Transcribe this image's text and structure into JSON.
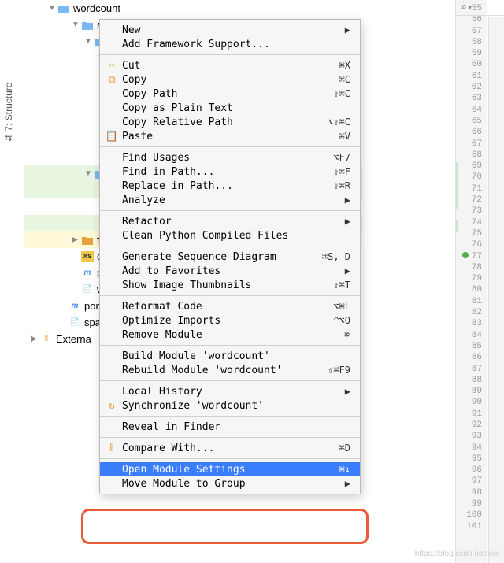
{
  "sidebar": {
    "structure_label": "Structure"
  },
  "tree": {
    "root": "wordcount",
    "items": [
      {
        "label": "s",
        "indent": 1,
        "chevron": "down",
        "icon": "folder-blue"
      },
      {
        "label": "",
        "indent": 2,
        "chevron": "down",
        "icon": "folder-blue"
      },
      {
        "label": "",
        "indent": 3,
        "chevron": "down",
        "icon": "folder-blue"
      },
      {
        "label": "",
        "indent": 4,
        "chevron": "down",
        "icon": "folder-blue"
      },
      {
        "label": "",
        "indent": 4,
        "chevron": "",
        "icon": ""
      },
      {
        "label": "",
        "indent": 4,
        "chevron": "",
        "icon": ""
      },
      {
        "label": "",
        "indent": 4,
        "chevron": "",
        "icon": ""
      },
      {
        "label": "",
        "indent": 4,
        "chevron": "",
        "icon": ""
      },
      {
        "label": "",
        "indent": 4,
        "chevron": "",
        "icon": ""
      },
      {
        "label": "",
        "indent": 2,
        "chevron": "down",
        "icon": "folder-blue",
        "class": "green"
      },
      {
        "label": "",
        "indent": 2,
        "chevron": "",
        "icon": "",
        "class": "green"
      },
      {
        "label": "",
        "indent": 2,
        "chevron": "",
        "icon": ""
      },
      {
        "label": "",
        "indent": 2,
        "chevron": "",
        "icon": "",
        "class": "green"
      },
      {
        "label": "t",
        "indent": 1,
        "chevron": "right",
        "icon": "folder-orange",
        "class": "yellow"
      },
      {
        "label": "d",
        "indent": 1,
        "chevron": "",
        "icon": "xml"
      },
      {
        "label": "p",
        "indent": 1,
        "chevron": "",
        "icon": "m"
      },
      {
        "label": "w",
        "indent": 1,
        "chevron": "",
        "icon": "file"
      },
      {
        "label": "pom.",
        "indent": 0,
        "chevron": "",
        "icon": "m"
      },
      {
        "label": "spar",
        "indent": 0,
        "chevron": "",
        "icon": "file"
      }
    ],
    "external": "Externa"
  },
  "menu": {
    "groups": [
      [
        {
          "label": "New",
          "arrow": true
        },
        {
          "label": "Add Framework Support..."
        }
      ],
      [
        {
          "label": "Cut",
          "shortcut": "⌘X",
          "icon": "scissors"
        },
        {
          "label": "Copy",
          "shortcut": "⌘C",
          "icon": "copy"
        },
        {
          "label": "Copy Path",
          "shortcut": "⇧⌘C"
        },
        {
          "label": "Copy as Plain Text"
        },
        {
          "label": "Copy Relative Path",
          "shortcut": "⌥⇧⌘C"
        },
        {
          "label": "Paste",
          "shortcut": "⌘V",
          "icon": "paste"
        }
      ],
      [
        {
          "label": "Find Usages",
          "shortcut": "⌥F7"
        },
        {
          "label": "Find in Path...",
          "shortcut": "⇧⌘F"
        },
        {
          "label": "Replace in Path...",
          "shortcut": "⇧⌘R"
        },
        {
          "label": "Analyze",
          "arrow": true
        }
      ],
      [
        {
          "label": "Refactor",
          "arrow": true
        },
        {
          "label": "Clean Python Compiled Files"
        }
      ],
      [
        {
          "label": "Generate Sequence Diagram",
          "shortcut": "⌘S, D"
        },
        {
          "label": "Add to Favorites",
          "arrow": true
        },
        {
          "label": "Show Image Thumbnails",
          "shortcut": "⇧⌘T"
        }
      ],
      [
        {
          "label": "Reformat Code",
          "shortcut": "⌥⌘L"
        },
        {
          "label": "Optimize Imports",
          "shortcut": "^⌥O"
        },
        {
          "label": "Remove Module",
          "shortcut": "⌦"
        }
      ],
      [
        {
          "label": "Build Module 'wordcount'"
        },
        {
          "label": "Rebuild Module 'wordcount'",
          "shortcut": "⇧⌘F9"
        }
      ],
      [
        {
          "label": "Local History",
          "arrow": true
        },
        {
          "label": "Synchronize 'wordcount'",
          "icon": "sync"
        }
      ],
      [
        {
          "label": "Reveal in Finder"
        }
      ],
      [
        {
          "label": "Compare With...",
          "shortcut": "⌘D",
          "icon": "compare"
        }
      ],
      [
        {
          "label": "Open Module Settings",
          "shortcut": "⌘↓",
          "selected": true
        },
        {
          "label": "Move Module to Group",
          "arrow": true
        }
      ]
    ]
  },
  "gutter": {
    "start": 55,
    "end": 101
  },
  "watermark": "https://blog.csdn.net/xxx"
}
